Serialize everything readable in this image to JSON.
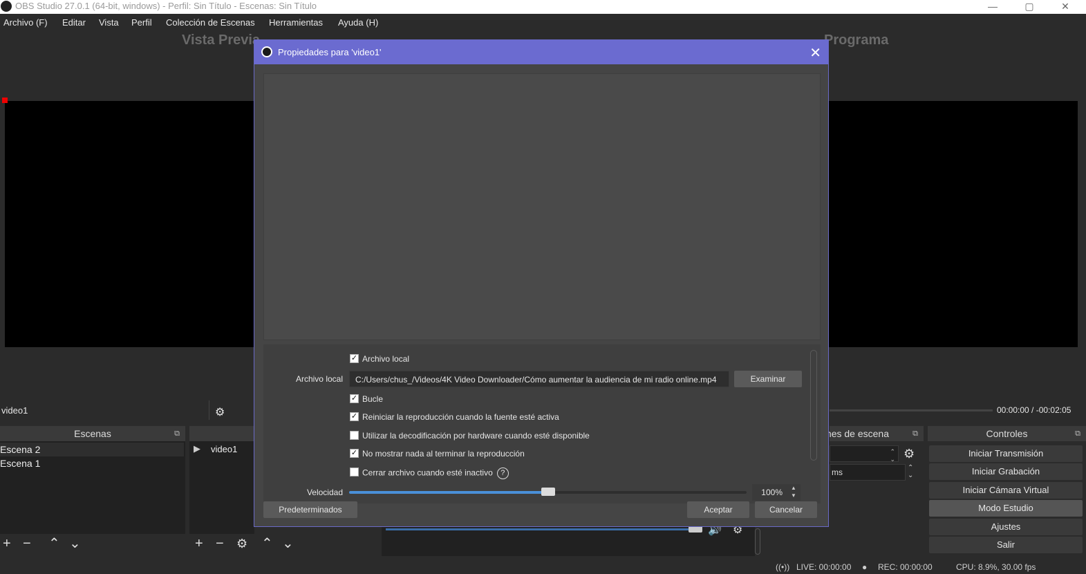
{
  "window": {
    "title": "OBS Studio 27.0.1 (64-bit, windows) - Perfil: Sin Título - Escenas: Sin Título",
    "minimize": "—",
    "maximize": "▢",
    "close": "✕"
  },
  "menu": [
    "Archivo (F)",
    "Editar",
    "Vista",
    "Perfil",
    "Colección de Escenas",
    "Herramientas",
    "Ayuda (H)"
  ],
  "preview": {
    "left_title": "Vista Previa",
    "right_title": "Programa"
  },
  "source_bar": {
    "selected_source": "video1",
    "properties_label": "Propiedades",
    "timecode": "00:00:00 / -00:02:05"
  },
  "scenes": {
    "header": "Escenas",
    "items": [
      "Escena 2",
      "Escena 1"
    ]
  },
  "sources": {
    "items": [
      "video1"
    ]
  },
  "transitions": {
    "header": "Transiciones de escena",
    "duration_unit": "ms"
  },
  "controls": {
    "header": "Controles",
    "buttons": [
      "Iniciar Transmisión",
      "Iniciar Grabación",
      "Iniciar Cámara Virtual",
      "Modo Estudio",
      "Ajustes",
      "Salir"
    ]
  },
  "status": {
    "live": "LIVE: 00:00:00",
    "rec": "REC: 00:00:00",
    "cpu": "CPU: 8.9%, 30.00 fps"
  },
  "dialog": {
    "title": "Propiedades para 'video1'",
    "local_file_checkbox": {
      "label": "Archivo local",
      "checked": true
    },
    "local_file_label": "Archivo local",
    "local_file_path": "C:/Users/chus_/Videos/4K Video Downloader/Cómo aumentar la audiencia de mi radio online.mp4",
    "browse_label": "Examinar",
    "options": [
      {
        "label": "Bucle",
        "checked": true
      },
      {
        "label": "Reiniciar la reproducción cuando la fuente esté activa",
        "checked": true
      },
      {
        "label": "Utilizar la decodificación por hardware cuando esté disponible",
        "checked": false
      },
      {
        "label": "No mostrar nada al terminar la reproducción",
        "checked": true
      },
      {
        "label": "Cerrar archivo cuando esté inactivo",
        "checked": false
      }
    ],
    "speed_label": "Velocidad",
    "speed_value": "100%",
    "speed_fraction": 0.5,
    "defaults_button": "Predeterminados",
    "accept_button": "Aceptar",
    "cancel_button": "Cancelar"
  }
}
